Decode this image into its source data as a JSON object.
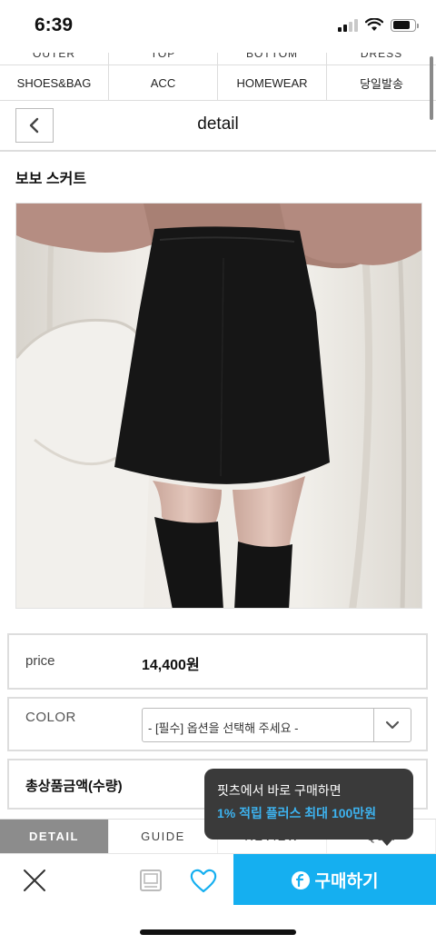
{
  "status_bar": {
    "time": "6:39"
  },
  "categories": {
    "partial_row": [
      "OUTER",
      "TOP",
      "BOTTOM",
      "DRESS"
    ],
    "row": [
      "SHOES&BAG",
      "ACC",
      "HOMEWEAR",
      "당일발송"
    ]
  },
  "header": {
    "title": "detail",
    "back_icon": "chevron-left-icon"
  },
  "product": {
    "name": "보보 스커트",
    "price_label": "price",
    "price_value": "14,400원",
    "color_label": "COLOR",
    "color_select_value": "- [필수] 옵션을 선택해 주세요 -",
    "total_label": "총상품금액(수량)"
  },
  "tabs": [
    {
      "label": "DETAIL",
      "active": true
    },
    {
      "label": "GUIDE",
      "active": false
    },
    {
      "label": "REVIEW",
      "active": false
    },
    {
      "label": "Q&A",
      "active": false
    }
  ],
  "tooltip": {
    "line1": "핏츠에서 바로 구매하면",
    "line2": "1% 적립 플러스 최대 100만원"
  },
  "bottom_bar": {
    "buy_label": "구매하기",
    "buy_color": "#15aff0",
    "icons": [
      "close-icon",
      "bookmark-icon",
      "heart-icon"
    ]
  }
}
